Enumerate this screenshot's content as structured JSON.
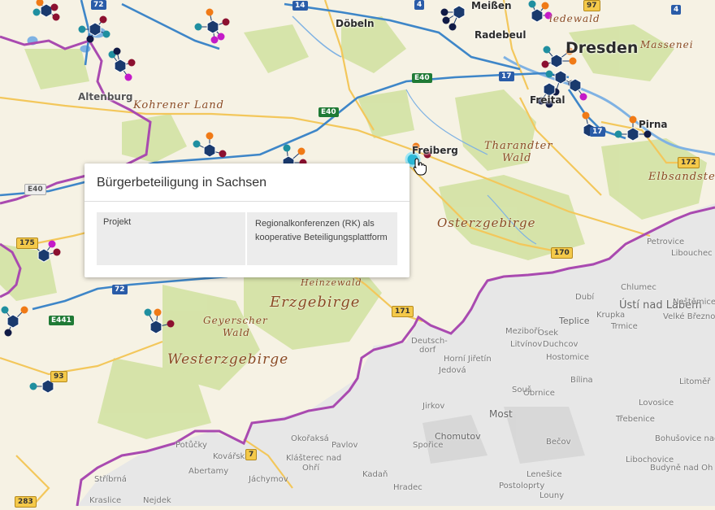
{
  "popup": {
    "title": "Bürgerbeteiligung in Sachsen",
    "field_label": "Projekt",
    "field_value": "Regionalkonferenzen (RK) als kooperative Beteiligungsplattform"
  },
  "cities": {
    "dresden": "Dresden",
    "freiberg": "Freiberg",
    "pirna": "Pirna",
    "meissen": "Meißen",
    "radebeul": "Radebeul",
    "doebeln": "Döbeln",
    "altenburg": "Altenburg",
    "freital": "Freital"
  },
  "regions": {
    "kohrener_land": "Kohrener Land",
    "tharandter_wald": [
      "Tharandter",
      "Wald"
    ],
    "osterzgebirge": "Osterzgebirge",
    "erzgebirge": "Erzgebirge",
    "heinzewald": "Heinzewald",
    "geyerscher_wald": [
      "Geyerscher",
      "Wald"
    ],
    "westerzgebirge": "Westerzgebirge",
    "elbsandstein": "Elbsandste",
    "massenei": "Massenei",
    "friedewald": "iedewald"
  },
  "czech": {
    "usti": "Ústí nad Labem",
    "teplice": "Teplice",
    "most": "Most",
    "chomutov": "Chomutov",
    "bilina": "Bílina",
    "litvinov": "Litvínov",
    "dubi": "Dubí",
    "chlumec": "Chlumec",
    "jirkov": "Jirkov",
    "lovosice": "Lovosice",
    "litomerice": "Litoměř",
    "petrovice": "Petrovice",
    "libouchec": "Libouchec",
    "klasterec": [
      "Klášterec nad",
      "Ohří"
    ],
    "kadan": "Kadaň",
    "louny": "Louny",
    "becov": "Bečov",
    "postoloprty": "Postoloprty",
    "trebenice": "Třebenice",
    "osek": "Osek",
    "duchcov": "Duchcov",
    "hostomice": "Hostomice",
    "obrnice": "Obrnice",
    "sous": "Souš",
    "spoice": "Spořice",
    "pavlov": "Pavlov",
    "okoraksa": "Okořaksá",
    "abertamy": "Abertamy",
    "potucky": "Potůčky",
    "strbina": "Stříbrná",
    "krasl": "Kraslice",
    "nejdek": "Nejdek",
    "jachymov": "Jáchymov",
    "lenesice": "Lenešice",
    "mezibori": "Meziboří",
    "neste": "Neštěmice",
    "velke": "Velké Březno",
    "libochovice": "Libochovice",
    "budyne": "Budyně nad Oh",
    "deutsch": [
      "Deutsch-",
      "dorf"
    ],
    "hora": "Horní Jiřetín",
    "jedova": "Jedová",
    "trmice": "Trmice",
    "kovar": "Kovářská",
    "hradec": "Hradec",
    "bohusovice": "Bohušovice nad",
    "krupka": "Krupka"
  },
  "roads": {
    "a4_1": "4",
    "a4_2": "4",
    "a14": "14",
    "a72_top": "72",
    "a72_mid": "72",
    "a17_1": "17",
    "a17_2": "17",
    "e40_1": "E40",
    "e40_2": "E40",
    "e40_left": "E40",
    "e441": "E441",
    "b97": "97",
    "b175": "175",
    "b170": "170",
    "b171": "171",
    "b172": "172",
    "b283": "283",
    "b93": "93",
    "b7": "7"
  },
  "colors": {
    "map_bg": "#f6f2e4",
    "forest": "#d3e2a3",
    "border": "#a94ab0",
    "cz_bg": "#e7e7e7",
    "autobahn": "#3e86c8",
    "main_road": "#f3c75b",
    "water": "#7fb2e3",
    "hexagon": "#1a3a6e",
    "teal": "#1f8fa0",
    "orange": "#f07a16",
    "dark_red": "#8c1030",
    "magenta": "#c41ac8",
    "navy": "#101a45",
    "cyan_highlight": "#2bb8d6"
  }
}
